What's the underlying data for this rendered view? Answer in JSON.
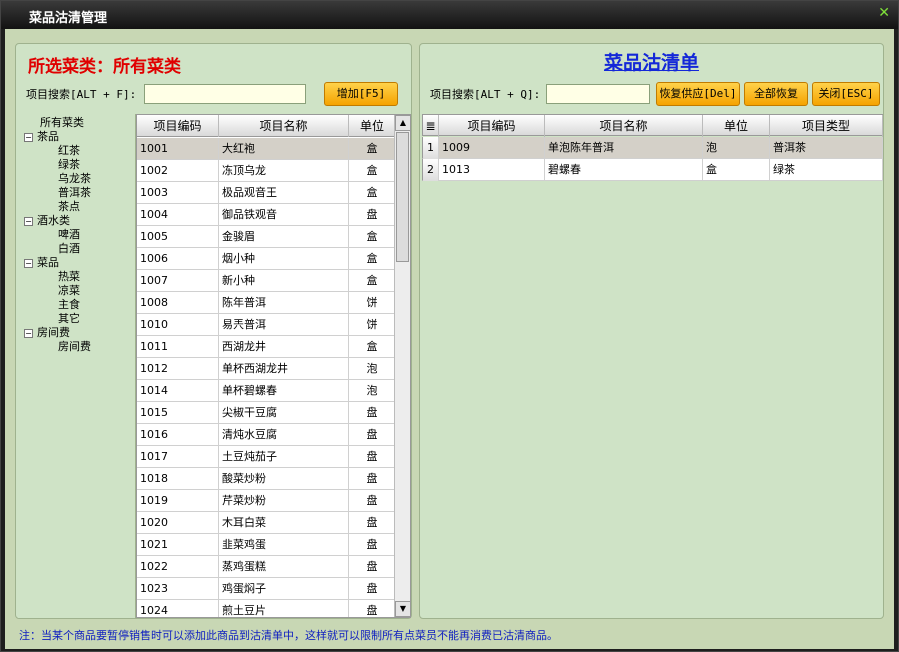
{
  "window": {
    "title": "菜品沽清管理",
    "close_glyph": "✕"
  },
  "left": {
    "heading": "所选菜类：所有菜类",
    "search_label": "项目搜索[ALT + F]:",
    "search_value": "",
    "add_button": "增加[F5]",
    "tree": {
      "root": "所有菜类",
      "groups": [
        {
          "label": "茶品",
          "children": [
            "红茶",
            "绿茶",
            "乌龙茶",
            "普洱茶",
            "茶点"
          ]
        },
        {
          "label": "酒水类",
          "children": [
            "啤酒",
            "白酒"
          ]
        },
        {
          "label": "菜品",
          "children": [
            "热菜",
            "凉菜",
            "主食",
            "其它"
          ]
        },
        {
          "label": "房间费",
          "children": [
            "房间费"
          ]
        }
      ],
      "toggle_glyph": "−"
    },
    "columns": [
      "项目编码",
      "项目名称",
      "单位"
    ],
    "rows": [
      [
        "1001",
        "大红袍",
        "盒"
      ],
      [
        "1002",
        "冻顶乌龙",
        "盒"
      ],
      [
        "1003",
        "极品观音王",
        "盒"
      ],
      [
        "1004",
        "御品铁观音",
        "盘"
      ],
      [
        "1005",
        "金骏眉",
        "盒"
      ],
      [
        "1006",
        "烟小种",
        "盒"
      ],
      [
        "1007",
        "新小种",
        "盒"
      ],
      [
        "1008",
        "陈年普洱",
        "饼"
      ],
      [
        "1010",
        "易兲普洱",
        "饼"
      ],
      [
        "1011",
        "西湖龙井",
        "盒"
      ],
      [
        "1012",
        "单杯西湖龙井",
        "泡"
      ],
      [
        "1014",
        "单杯碧螺春",
        "泡"
      ],
      [
        "1015",
        "尖椒干豆腐",
        "盘"
      ],
      [
        "1016",
        "清炖水豆腐",
        "盘"
      ],
      [
        "1017",
        "土豆炖茄子",
        "盘"
      ],
      [
        "1018",
        "酸菜炒粉",
        "盘"
      ],
      [
        "1019",
        "芹菜炒粉",
        "盘"
      ],
      [
        "1020",
        "木耳白菜",
        "盘"
      ],
      [
        "1021",
        "韭菜鸡蛋",
        "盘"
      ],
      [
        "1022",
        "蒸鸡蛋糕",
        "盘"
      ],
      [
        "1023",
        "鸡蛋焖子",
        "盘"
      ],
      [
        "1024",
        "煎土豆片",
        "盘"
      ]
    ],
    "scroll_up": "▲",
    "scroll_down": "▼"
  },
  "right": {
    "heading": "菜品沽清单",
    "search_label": "项目搜索[ALT + Q]:",
    "search_value": "",
    "restore_button": "恢复供应[Del]",
    "restore_all_button": "全部恢复",
    "close_button": "关闭[ESC]",
    "header_icon": "≣",
    "columns": [
      "项目编码",
      "项目名称",
      "单位",
      "项目类型"
    ],
    "rows": [
      [
        "1",
        "1009",
        "单泡陈年普洱",
        "泡",
        "普洱茶"
      ],
      [
        "2",
        "1013",
        "碧螺春",
        "盒",
        "绿茶"
      ]
    ]
  },
  "note": "注：当某个商品要暂停销售时可以添加此商品到沽清单中，这样就可以限制所有点菜员不能再消费已沽清商品。"
}
